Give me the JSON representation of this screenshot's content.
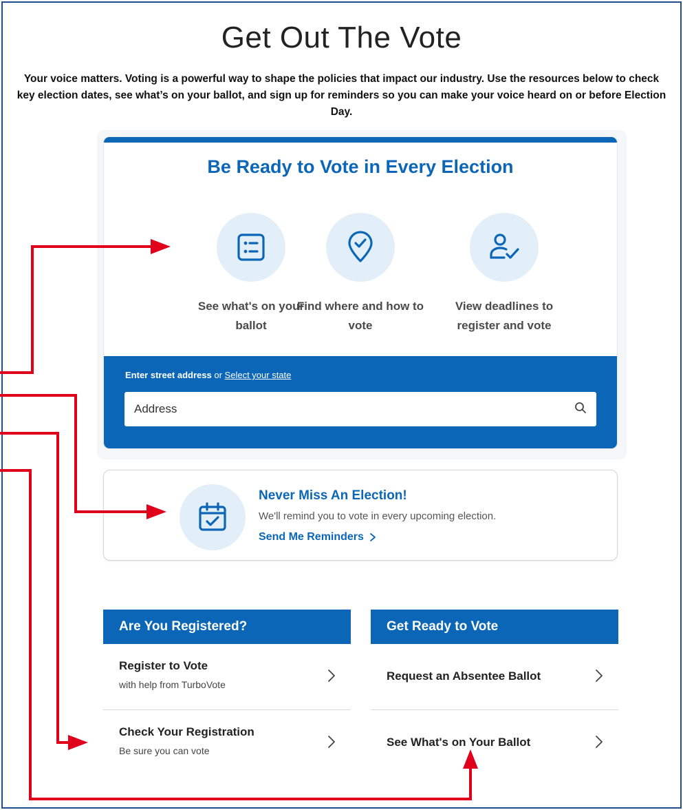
{
  "page": {
    "title": "Get Out The Vote",
    "intro": "Your voice matters. Voting is a powerful way to shape the policies that impact our industry. Use the resources below to check key election dates, see what’s on your ballot, and sign up for reminders so you can make your voice heard on or before Election Day."
  },
  "vote_card": {
    "heading": "Be Ready to Vote in Every Election",
    "features": [
      {
        "icon": "ballot-list-icon",
        "label": "See what's on your ballot"
      },
      {
        "icon": "location-check-icon",
        "label": "Find where and how to vote"
      },
      {
        "icon": "person-check-icon",
        "label": "View deadlines to register and vote"
      }
    ],
    "address": {
      "label_bold": "Enter street address",
      "label_or": "or",
      "select_state_link": "Select your state",
      "placeholder": "Address",
      "search_icon": "search-icon"
    }
  },
  "reminder": {
    "icon": "calendar-check-icon",
    "title": "Never Miss An Election!",
    "description": "We'll remind you to vote in every upcoming election.",
    "link": "Send Me Reminders"
  },
  "registered": {
    "heading": "Are You Registered?",
    "items": [
      {
        "title": "Register to Vote",
        "subtitle": "with help from TurboVote"
      },
      {
        "title": "Check Your Registration",
        "subtitle": "Be sure you can vote"
      }
    ]
  },
  "ready": {
    "heading": "Get Ready to Vote",
    "items": [
      {
        "title": "Request an Absentee Ballot"
      },
      {
        "title": "See What's on Your Ballot"
      }
    ]
  },
  "colors": {
    "brand_blue": "#0b66b8",
    "icon_circle": "#e3eff8",
    "annotation_red": "#e0001b",
    "frame_border": "#1f4e8c"
  }
}
